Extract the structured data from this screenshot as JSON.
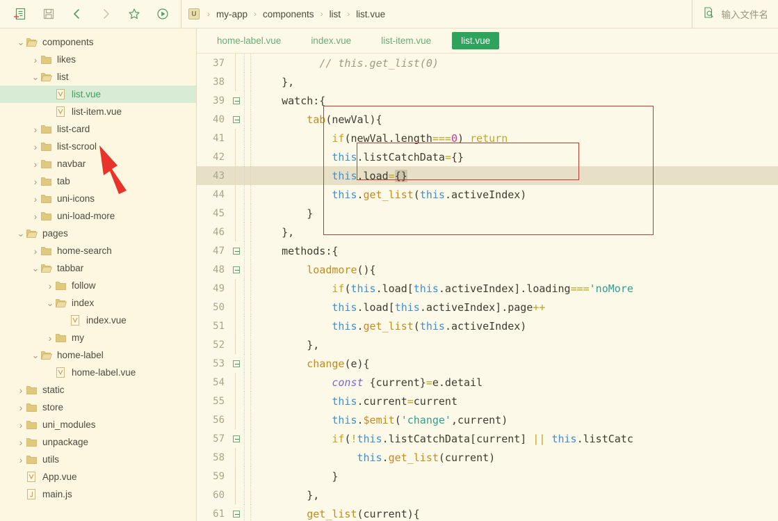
{
  "toolbar": {
    "buttons": [
      {
        "name": "new-file-icon",
        "title": "新建"
      },
      {
        "name": "save-icon",
        "title": "保存"
      },
      {
        "name": "back-icon",
        "title": "后退"
      },
      {
        "name": "forward-icon",
        "title": "前进"
      },
      {
        "name": "bookmark-star-icon",
        "title": "收藏"
      },
      {
        "name": "run-icon",
        "title": "运行"
      }
    ],
    "breadcrumb": {
      "project_badge": "U",
      "items": [
        "my-app",
        "components",
        "list",
        "list.vue"
      ],
      "separator": "›"
    },
    "search": {
      "placeholder": "输入文件名",
      "value": "",
      "icon": "file-search-icon"
    }
  },
  "sidebar": {
    "items": [
      {
        "label": "components",
        "depth": 0,
        "type": "folder",
        "state": "open"
      },
      {
        "label": "likes",
        "depth": 1,
        "type": "folder",
        "state": "closed"
      },
      {
        "label": "list",
        "depth": 1,
        "type": "folder",
        "state": "open"
      },
      {
        "label": "list.vue",
        "depth": 2,
        "type": "vue",
        "state": "none",
        "selected": true
      },
      {
        "label": "list-item.vue",
        "depth": 2,
        "type": "vue",
        "state": "none"
      },
      {
        "label": "list-card",
        "depth": 1,
        "type": "folder",
        "state": "closed"
      },
      {
        "label": "list-scrool",
        "depth": 1,
        "type": "folder",
        "state": "closed"
      },
      {
        "label": "navbar",
        "depth": 1,
        "type": "folder",
        "state": "closed"
      },
      {
        "label": "tab",
        "depth": 1,
        "type": "folder",
        "state": "closed"
      },
      {
        "label": "uni-icons",
        "depth": 1,
        "type": "folder",
        "state": "closed"
      },
      {
        "label": "uni-load-more",
        "depth": 1,
        "type": "folder",
        "state": "closed"
      },
      {
        "label": "pages",
        "depth": 0,
        "type": "folder",
        "state": "open"
      },
      {
        "label": "home-search",
        "depth": 1,
        "type": "folder",
        "state": "closed"
      },
      {
        "label": "tabbar",
        "depth": 1,
        "type": "folder",
        "state": "open"
      },
      {
        "label": "follow",
        "depth": 2,
        "type": "folder",
        "state": "closed"
      },
      {
        "label": "index",
        "depth": 2,
        "type": "folder",
        "state": "open"
      },
      {
        "label": "index.vue",
        "depth": 3,
        "type": "vue",
        "state": "none"
      },
      {
        "label": "my",
        "depth": 2,
        "type": "folder",
        "state": "closed"
      },
      {
        "label": "home-label",
        "depth": 1,
        "type": "folder",
        "state": "open"
      },
      {
        "label": "home-label.vue",
        "depth": 2,
        "type": "vue",
        "state": "none"
      },
      {
        "label": "static",
        "depth": 0,
        "type": "folder",
        "state": "closed"
      },
      {
        "label": "store",
        "depth": 0,
        "type": "folder",
        "state": "closed"
      },
      {
        "label": "uni_modules",
        "depth": 0,
        "type": "folder",
        "state": "closed"
      },
      {
        "label": "unpackage",
        "depth": 0,
        "type": "folder",
        "state": "closed"
      },
      {
        "label": "utils",
        "depth": 0,
        "type": "folder",
        "state": "closed"
      },
      {
        "label": "App.vue",
        "depth": 0,
        "type": "vue",
        "state": "none"
      },
      {
        "label": "main.js",
        "depth": 0,
        "type": "js",
        "state": "none"
      }
    ]
  },
  "editor": {
    "tabs": [
      {
        "label": "home-label.vue",
        "active": false
      },
      {
        "label": "index.vue",
        "active": false
      },
      {
        "label": "list-item.vue",
        "active": false
      },
      {
        "label": "list.vue",
        "active": true
      }
    ],
    "first_line": 37,
    "current_line": 43,
    "lines": [
      {
        "n": 37,
        "fold": false,
        "guides": 2,
        "tokens": [
          {
            "t": "          ",
            "c": "t-plain"
          },
          {
            "t": "// this.get_list(0)",
            "c": "t-comment"
          }
        ]
      },
      {
        "n": 38,
        "fold": false,
        "guides": 1,
        "tokens": [
          {
            "t": "    },",
            "c": "t-plain"
          }
        ]
      },
      {
        "n": 39,
        "fold": true,
        "guides": 1,
        "tokens": [
          {
            "t": "    watch:{",
            "c": "t-plain"
          }
        ]
      },
      {
        "n": 40,
        "fold": true,
        "guides": 2,
        "tokens": [
          {
            "t": "        ",
            "c": "t-plain"
          },
          {
            "t": "tab",
            "c": "t-fn"
          },
          {
            "t": "(newVal){",
            "c": "t-plain"
          }
        ]
      },
      {
        "n": 41,
        "fold": false,
        "guides": 3,
        "tokens": [
          {
            "t": "            ",
            "c": "t-plain"
          },
          {
            "t": "if",
            "c": "t-kw"
          },
          {
            "t": "(newVal.length",
            "c": "t-plain"
          },
          {
            "t": "===",
            "c": "t-op"
          },
          {
            "t": "0",
            "c": "t-num"
          },
          {
            "t": ") ",
            "c": "t-plain"
          },
          {
            "t": "return",
            "c": "t-kw"
          }
        ]
      },
      {
        "n": 42,
        "fold": false,
        "guides": 3,
        "tokens": [
          {
            "t": "            ",
            "c": "t-plain"
          },
          {
            "t": "this",
            "c": "t-this"
          },
          {
            "t": ".listCatchData",
            "c": "t-plain"
          },
          {
            "t": "=",
            "c": "t-op"
          },
          {
            "t": "{}",
            "c": "t-plain"
          }
        ]
      },
      {
        "n": 43,
        "fold": false,
        "guides": 3,
        "current": true,
        "tokens": [
          {
            "t": "            ",
            "c": "t-plain"
          },
          {
            "t": "this",
            "c": "t-this"
          },
          {
            "t": ".load",
            "c": "t-plain"
          },
          {
            "t": "=",
            "c": "t-op"
          },
          {
            "t": "{",
            "c": "t-plain",
            "boxed": true
          },
          {
            "t": "CARET",
            "c": "caret"
          },
          {
            "t": "}",
            "c": "t-plain",
            "boxed": true
          }
        ]
      },
      {
        "n": 44,
        "fold": false,
        "guides": 3,
        "tokens": [
          {
            "t": "            ",
            "c": "t-plain"
          },
          {
            "t": "this",
            "c": "t-this"
          },
          {
            "t": ".",
            "c": "t-plain"
          },
          {
            "t": "get_list",
            "c": "t-fn"
          },
          {
            "t": "(",
            "c": "t-plain"
          },
          {
            "t": "this",
            "c": "t-this"
          },
          {
            "t": ".activeIndex)",
            "c": "t-plain"
          }
        ]
      },
      {
        "n": 45,
        "fold": false,
        "guides": 2,
        "tokens": [
          {
            "t": "        }",
            "c": "t-plain"
          }
        ]
      },
      {
        "n": 46,
        "fold": false,
        "guides": 1,
        "tokens": [
          {
            "t": "    },",
            "c": "t-plain"
          }
        ]
      },
      {
        "n": 47,
        "fold": true,
        "guides": 1,
        "tokens": [
          {
            "t": "    methods:{",
            "c": "t-plain"
          }
        ]
      },
      {
        "n": 48,
        "fold": true,
        "guides": 2,
        "tokens": [
          {
            "t": "        ",
            "c": "t-plain"
          },
          {
            "t": "loadmore",
            "c": "t-fn"
          },
          {
            "t": "(){",
            "c": "t-plain"
          }
        ]
      },
      {
        "n": 49,
        "fold": false,
        "guides": 3,
        "tokens": [
          {
            "t": "            ",
            "c": "t-plain"
          },
          {
            "t": "if",
            "c": "t-kw"
          },
          {
            "t": "(",
            "c": "t-plain"
          },
          {
            "t": "this",
            "c": "t-this"
          },
          {
            "t": ".load[",
            "c": "t-plain"
          },
          {
            "t": "this",
            "c": "t-this"
          },
          {
            "t": ".activeIndex].loading",
            "c": "t-plain"
          },
          {
            "t": "===",
            "c": "t-op"
          },
          {
            "t": "'noMore",
            "c": "t-str"
          }
        ]
      },
      {
        "n": 50,
        "fold": false,
        "guides": 3,
        "tokens": [
          {
            "t": "            ",
            "c": "t-plain"
          },
          {
            "t": "this",
            "c": "t-this"
          },
          {
            "t": ".load[",
            "c": "t-plain"
          },
          {
            "t": "this",
            "c": "t-this"
          },
          {
            "t": ".activeIndex].page",
            "c": "t-plain"
          },
          {
            "t": "++",
            "c": "t-op"
          }
        ]
      },
      {
        "n": 51,
        "fold": false,
        "guides": 3,
        "tokens": [
          {
            "t": "            ",
            "c": "t-plain"
          },
          {
            "t": "this",
            "c": "t-this"
          },
          {
            "t": ".",
            "c": "t-plain"
          },
          {
            "t": "get_list",
            "c": "t-fn"
          },
          {
            "t": "(",
            "c": "t-plain"
          },
          {
            "t": "this",
            "c": "t-this"
          },
          {
            "t": ".activeIndex)",
            "c": "t-plain"
          }
        ]
      },
      {
        "n": 52,
        "fold": false,
        "foldEnd": true,
        "guides": 2,
        "tokens": [
          {
            "t": "        },",
            "c": "t-plain"
          }
        ]
      },
      {
        "n": 53,
        "fold": true,
        "guides": 2,
        "tokens": [
          {
            "t": "        ",
            "c": "t-plain"
          },
          {
            "t": "change",
            "c": "t-fn"
          },
          {
            "t": "(e){",
            "c": "t-plain"
          }
        ]
      },
      {
        "n": 54,
        "fold": false,
        "guides": 3,
        "tokens": [
          {
            "t": "            ",
            "c": "t-plain"
          },
          {
            "t": "const",
            "c": "t-kw2"
          },
          {
            "t": " {current}",
            "c": "t-plain"
          },
          {
            "t": "=",
            "c": "t-op"
          },
          {
            "t": "e.detail",
            "c": "t-plain"
          }
        ]
      },
      {
        "n": 55,
        "fold": false,
        "guides": 3,
        "tokens": [
          {
            "t": "            ",
            "c": "t-plain"
          },
          {
            "t": "this",
            "c": "t-this"
          },
          {
            "t": ".current",
            "c": "t-plain"
          },
          {
            "t": "=",
            "c": "t-op"
          },
          {
            "t": "current",
            "c": "t-plain"
          }
        ]
      },
      {
        "n": 56,
        "fold": false,
        "guides": 3,
        "tokens": [
          {
            "t": "            ",
            "c": "t-plain"
          },
          {
            "t": "this",
            "c": "t-this"
          },
          {
            "t": ".",
            "c": "t-plain"
          },
          {
            "t": "$emit",
            "c": "t-fn"
          },
          {
            "t": "(",
            "c": "t-plain"
          },
          {
            "t": "'change'",
            "c": "t-str"
          },
          {
            "t": ",current)",
            "c": "t-plain"
          }
        ]
      },
      {
        "n": 57,
        "fold": true,
        "guides": 3,
        "tokens": [
          {
            "t": "            ",
            "c": "t-plain"
          },
          {
            "t": "if",
            "c": "t-kw"
          },
          {
            "t": "(",
            "c": "t-plain"
          },
          {
            "t": "!",
            "c": "t-op"
          },
          {
            "t": "this",
            "c": "t-this"
          },
          {
            "t": ".listCatchData[current] ",
            "c": "t-plain"
          },
          {
            "t": "||",
            "c": "t-op"
          },
          {
            "t": " ",
            "c": "t-plain"
          },
          {
            "t": "this",
            "c": "t-this"
          },
          {
            "t": ".listCatc",
            "c": "t-plain"
          }
        ]
      },
      {
        "n": 58,
        "fold": false,
        "guides": 4,
        "tokens": [
          {
            "t": "                ",
            "c": "t-plain"
          },
          {
            "t": "this",
            "c": "t-this"
          },
          {
            "t": ".",
            "c": "t-plain"
          },
          {
            "t": "get_list",
            "c": "t-fn"
          },
          {
            "t": "(current)",
            "c": "t-plain"
          }
        ]
      },
      {
        "n": 59,
        "fold": false,
        "foldEnd": true,
        "guides": 3,
        "tokens": [
          {
            "t": "            }",
            "c": "t-plain"
          }
        ]
      },
      {
        "n": 60,
        "fold": false,
        "foldEnd": true,
        "guides": 2,
        "tokens": [
          {
            "t": "        },",
            "c": "t-plain"
          }
        ]
      },
      {
        "n": 61,
        "fold": true,
        "guides": 2,
        "tokens": [
          {
            "t": "        ",
            "c": "t-plain"
          },
          {
            "t": "get_list",
            "c": "t-fn"
          },
          {
            "t": "(current){",
            "c": "t-plain"
          }
        ]
      }
    ]
  },
  "annotations": {
    "outer_box": {
      "label": "watch-block-highlight"
    },
    "inner_box": {
      "label": "load-reset-highlight"
    },
    "arrow": {
      "label": "pointer-to-list-vue",
      "color": "#e8332a"
    }
  },
  "colors": {
    "accent": "#2fa35c",
    "bg": "#fdf9e8",
    "sidebar_bg": "#fdf6e0",
    "selection": "#d8ecd5",
    "current_line": "#e7e0c6",
    "annotation_red": "#c0392b",
    "arrow_red": "#e8332a"
  }
}
